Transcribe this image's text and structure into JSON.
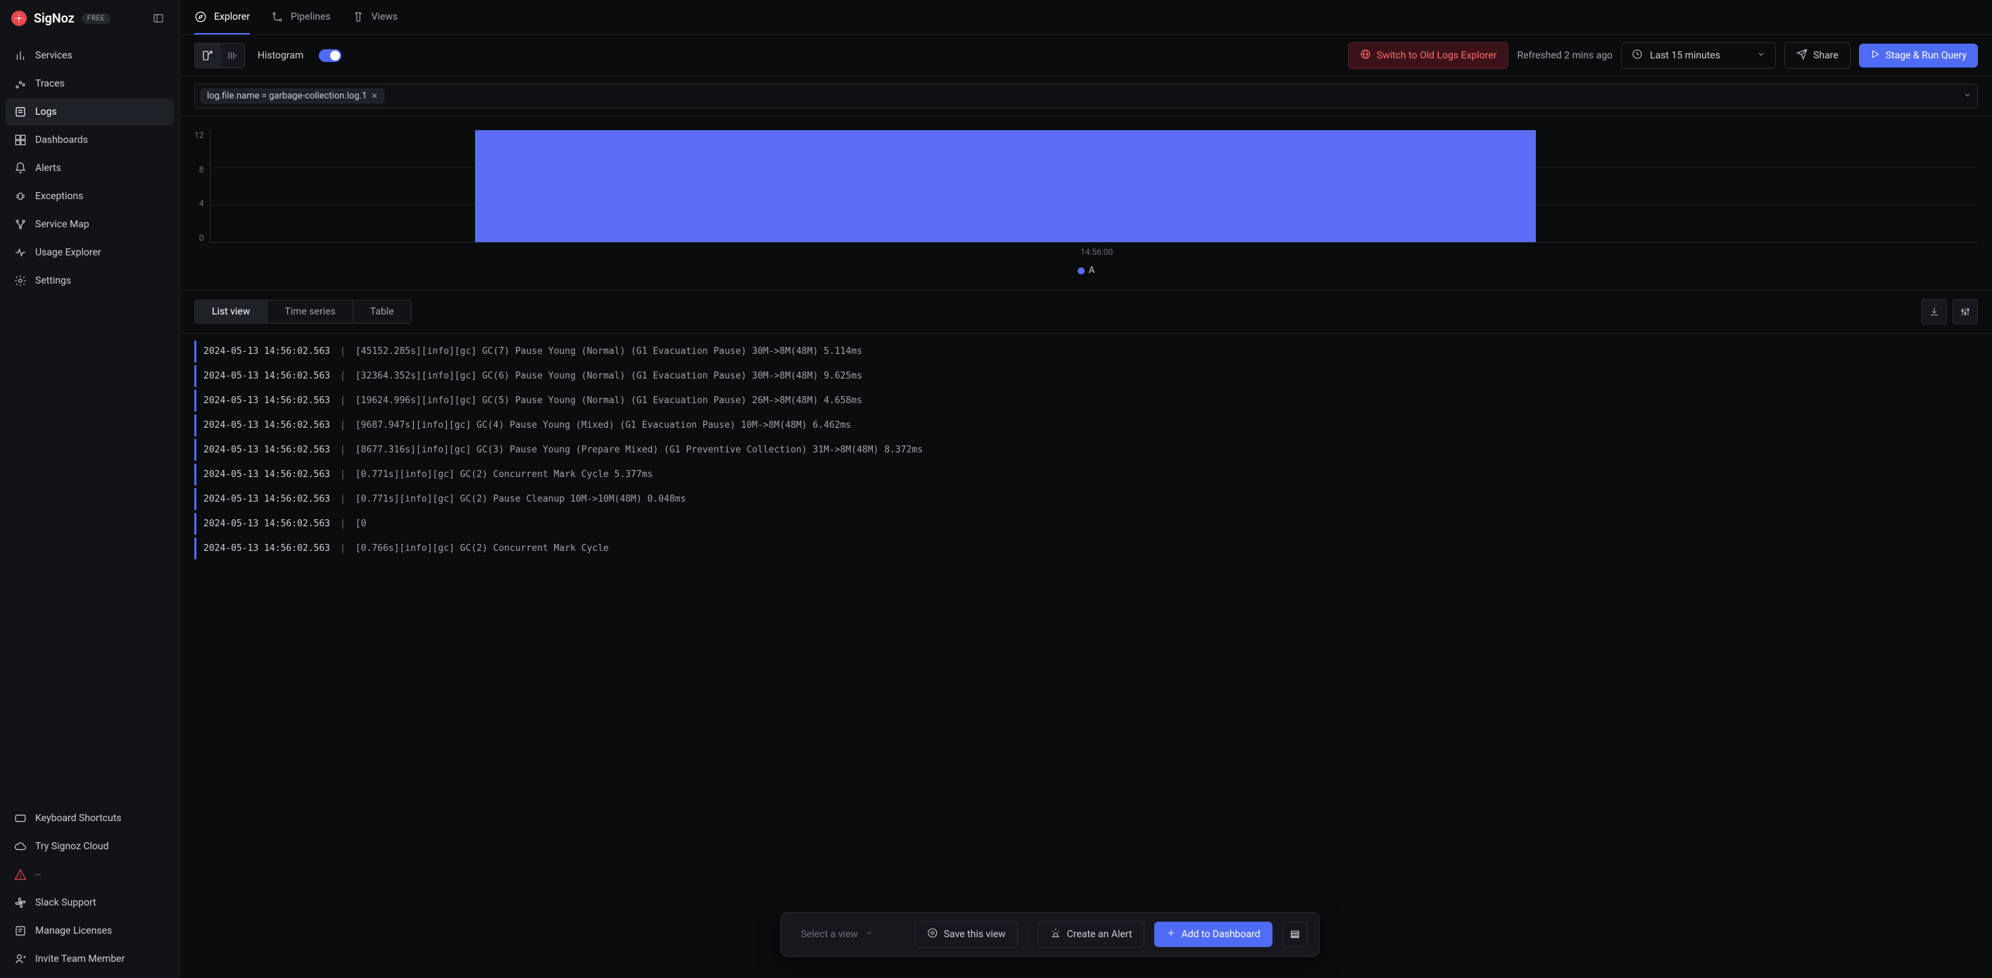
{
  "brand": {
    "name": "SigNoz",
    "plan": "FREE"
  },
  "sidebar": {
    "nav": [
      {
        "label": "Services"
      },
      {
        "label": "Traces"
      },
      {
        "label": "Logs"
      },
      {
        "label": "Dashboards"
      },
      {
        "label": "Alerts"
      },
      {
        "label": "Exceptions"
      },
      {
        "label": "Service Map"
      },
      {
        "label": "Usage Explorer"
      },
      {
        "label": "Settings"
      }
    ],
    "bottom": [
      {
        "label": "Keyboard Shortcuts"
      },
      {
        "label": "Try Signoz Cloud"
      },
      {
        "label": "--"
      },
      {
        "label": "Slack Support"
      },
      {
        "label": "Manage Licenses"
      },
      {
        "label": "Invite Team Member"
      }
    ]
  },
  "tabs": [
    {
      "label": "Explorer"
    },
    {
      "label": "Pipelines"
    },
    {
      "label": "Views"
    }
  ],
  "toolbar": {
    "visualization_label": "Histogram",
    "switch_label": "Switch to Old Logs Explorer",
    "refreshed": "Refreshed 2 mins ago",
    "time_range": "Last 15 minutes",
    "share": "Share",
    "run_query": "Stage & Run Query"
  },
  "filter": {
    "chip": "log.file.name = garbage-collection.log.1"
  },
  "chart_data": {
    "type": "bar",
    "categories": [
      "14:56:00"
    ],
    "values": [
      12
    ],
    "series_name": "A",
    "ylim": [
      0,
      12
    ],
    "yticks": [
      "12",
      "8",
      "4",
      "0"
    ],
    "xlabel": "14:56:00",
    "bar_position_pct": 15,
    "bar_width_pct": 60
  },
  "view_modes": [
    "List view",
    "Time series",
    "Table"
  ],
  "logs": [
    {
      "ts": "2024-05-13 14:56:02.563",
      "body": "[45152.285s][info][gc] GC(7) Pause Young (Normal) (G1 Evacuation Pause) 30M->8M(48M) 5.114ms"
    },
    {
      "ts": "2024-05-13 14:56:02.563",
      "body": "[32364.352s][info][gc] GC(6) Pause Young (Normal) (G1 Evacuation Pause) 30M->8M(48M) 9.625ms"
    },
    {
      "ts": "2024-05-13 14:56:02.563",
      "body": "[19624.996s][info][gc] GC(5) Pause Young (Normal) (G1 Evacuation Pause) 26M->8M(48M) 4.658ms"
    },
    {
      "ts": "2024-05-13 14:56:02.563",
      "body": "[9687.947s][info][gc] GC(4) Pause Young (Mixed) (G1 Evacuation Pause) 10M->8M(48M) 6.462ms"
    },
    {
      "ts": "2024-05-13 14:56:02.563",
      "body": "[8677.316s][info][gc] GC(3) Pause Young (Prepare Mixed) (G1 Preventive Collection) 31M->8M(48M) 8.372ms"
    },
    {
      "ts": "2024-05-13 14:56:02.563",
      "body": "[0.771s][info][gc] GC(2) Concurrent Mark Cycle 5.377ms"
    },
    {
      "ts": "2024-05-13 14:56:02.563",
      "body": "[0.771s][info][gc] GC(2) Pause Cleanup 10M->10M(48M) 0.048ms"
    },
    {
      "ts": "2024-05-13 14:56:02.563",
      "body": "[0"
    },
    {
      "ts": "2024-05-13 14:56:02.563",
      "body": "[0.766s][info][gc] GC(2) Concurrent Mark Cycle"
    }
  ],
  "float_bar": {
    "select_placeholder": "Select a view",
    "save_view": "Save this view",
    "create_alert": "Create an Alert",
    "add_dashboard": "Add to Dashboard"
  }
}
